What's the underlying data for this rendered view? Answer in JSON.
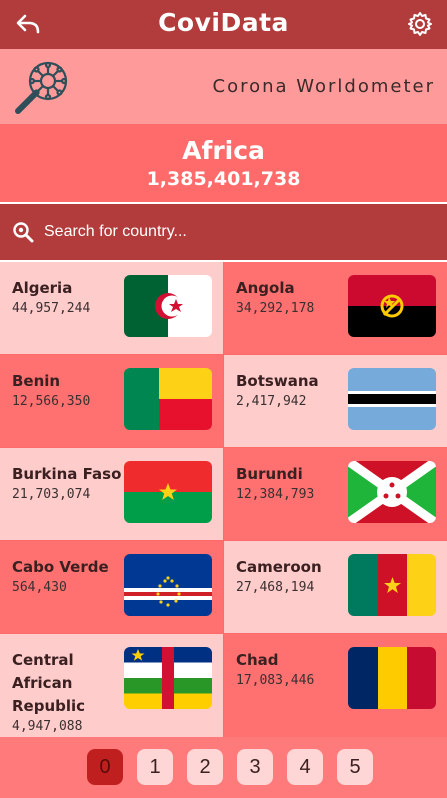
{
  "app": {
    "title": "CoviData",
    "subtitle": "Corona Worldometer",
    "back_icon": "back-arrow-icon",
    "settings_icon": "gear-icon",
    "logo_icon": "virus-magnifier-icon"
  },
  "region": {
    "name": "Africa",
    "population": "1,385,401,738"
  },
  "search": {
    "placeholder": "Search for country..."
  },
  "countries": [
    {
      "name": "Algeria",
      "population": "44,957,244",
      "flag": "algeria"
    },
    {
      "name": "Angola",
      "population": "34,292,178",
      "flag": "angola"
    },
    {
      "name": "Benin",
      "population": "12,566,350",
      "flag": "benin"
    },
    {
      "name": "Botswana",
      "population": "2,417,942",
      "flag": "botswana"
    },
    {
      "name": "Burkina Faso",
      "population": "21,703,074",
      "flag": "burkina-faso"
    },
    {
      "name": "Burundi",
      "population": "12,384,793",
      "flag": "burundi"
    },
    {
      "name": "Cabo Verde",
      "population": "564,430",
      "flag": "cabo-verde"
    },
    {
      "name": "Cameroon",
      "population": "27,468,194",
      "flag": "cameroon"
    },
    {
      "name": "Central African Republic",
      "population": "4,947,088",
      "flag": "central-african-republic"
    },
    {
      "name": "Chad",
      "population": "17,083,446",
      "flag": "chad"
    }
  ],
  "pagination": {
    "pages": [
      "0",
      "1",
      "2",
      "3",
      "4",
      "5"
    ],
    "current": "0"
  },
  "colors": {
    "appbar": "#b23c3c",
    "banner": "#ff9a9a",
    "region": "#ff6b6b",
    "card_light": "#ffcccc",
    "card_dark": "#ff7070",
    "active_page": "#c01f1f"
  }
}
